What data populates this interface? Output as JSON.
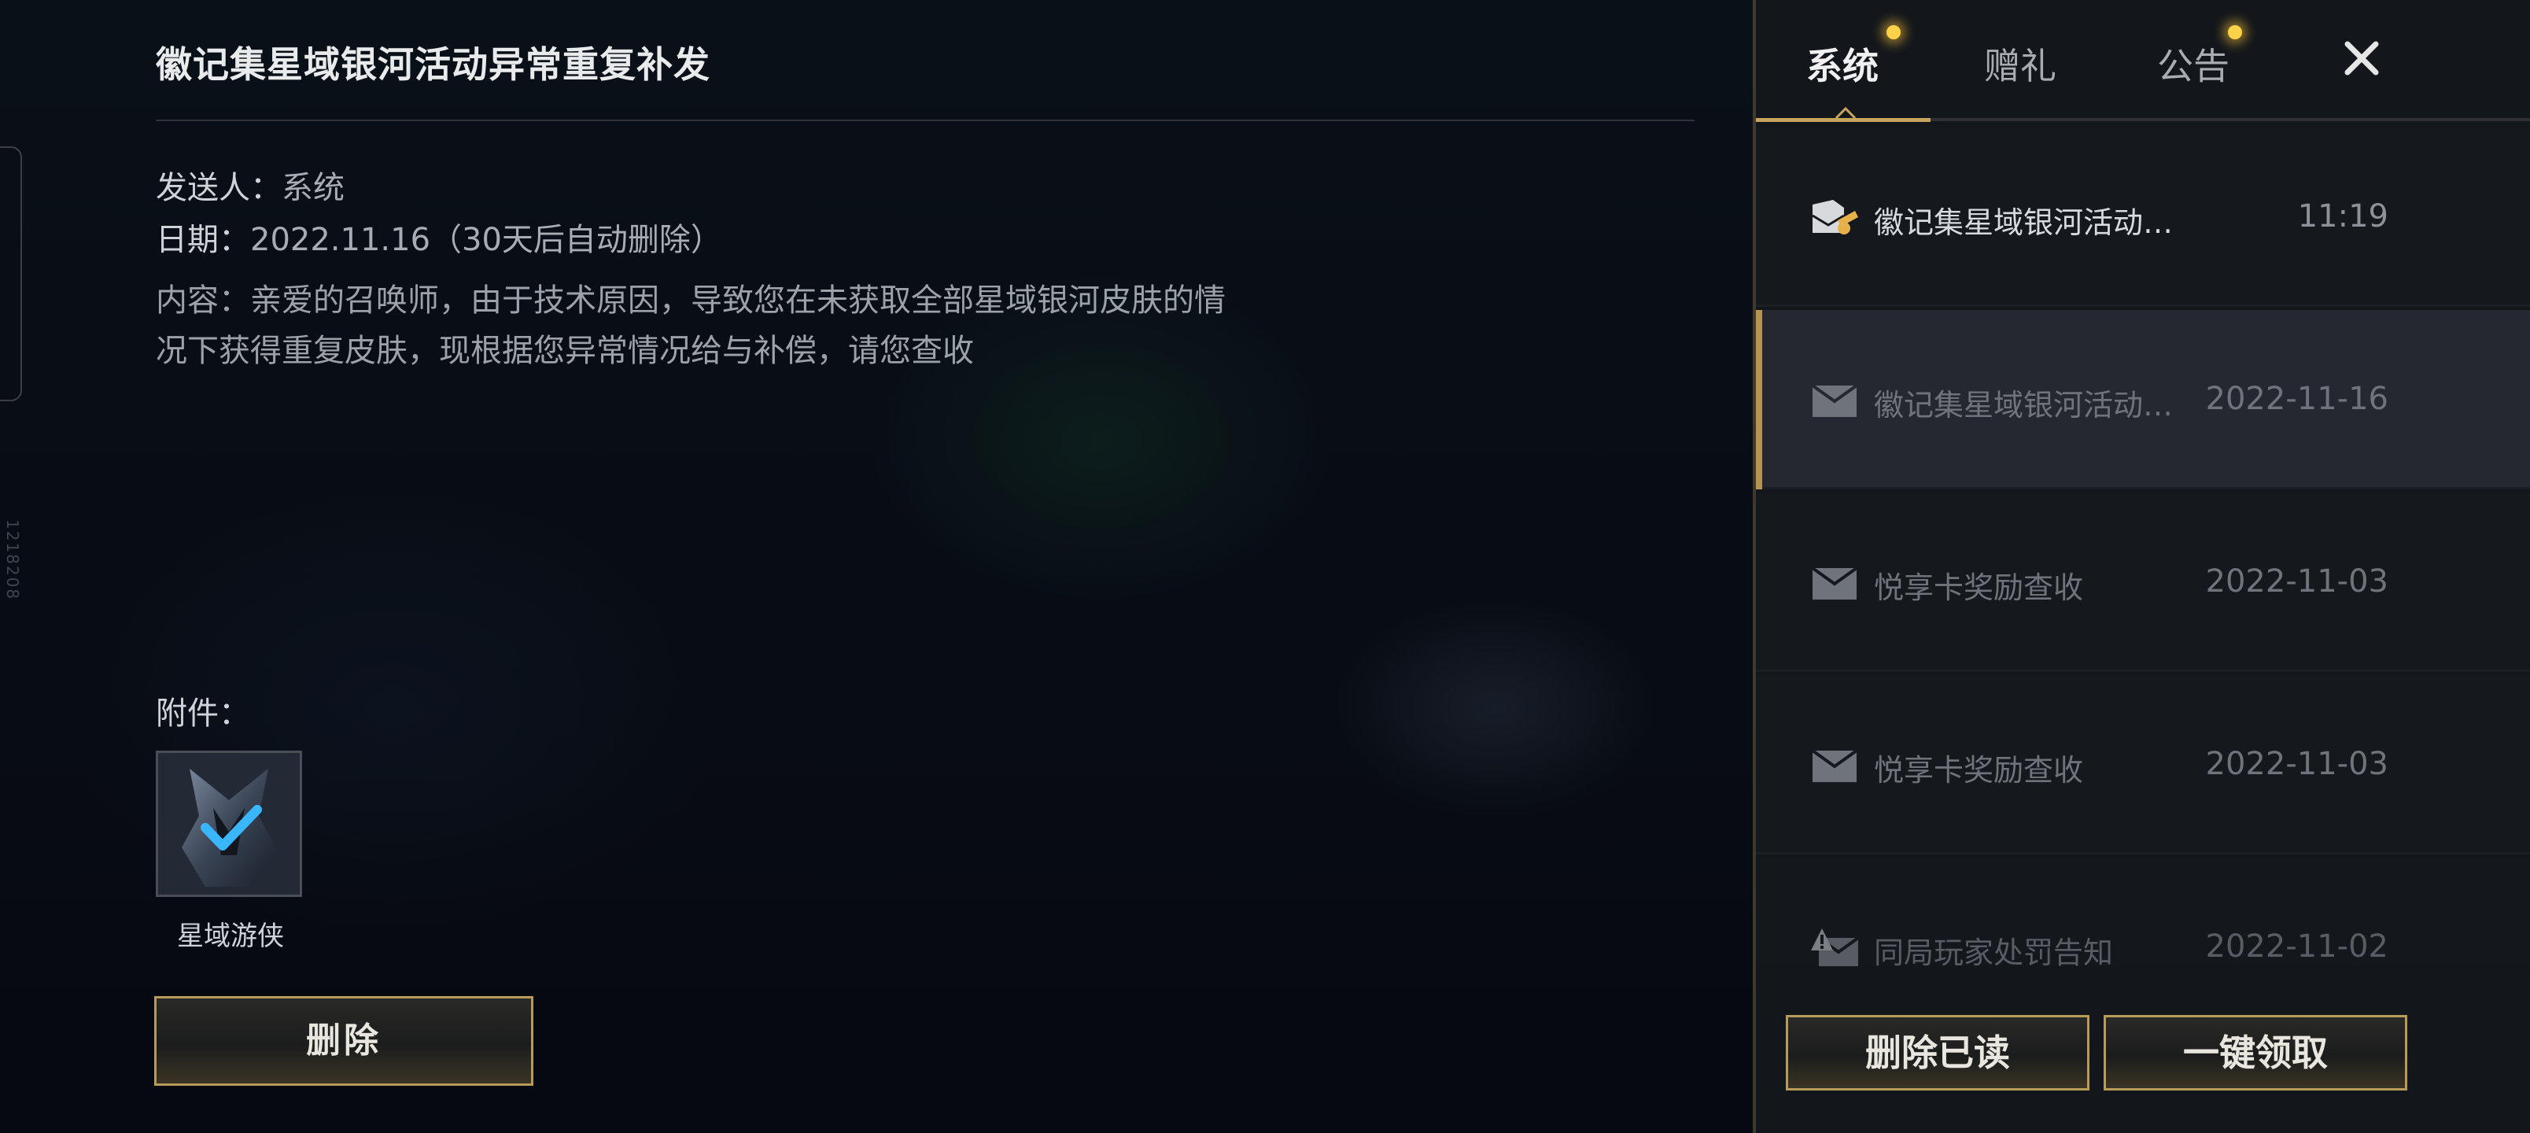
{
  "mail_detail": {
    "title": "徽记集星域银河活动异常重复补发",
    "sender_label": "发送人：",
    "sender_value": "系统",
    "date_label": "日期：",
    "date_value": "2022.11.16（30天后自动删除）",
    "content_line1": "内容：亲爱的召唤师，由于技术原因，导致您在未获取全部星域银河皮肤的情",
    "content_line2": "况下获得重复皮肤，现根据您异常情况给与补偿，请您查收",
    "attachment_label": "附件：",
    "attachment_name": "星域游侠",
    "attachment_claimed": true,
    "delete_button": "删除"
  },
  "side_code": "1218208",
  "tabs": [
    {
      "label": "系统",
      "active": true,
      "notify": true
    },
    {
      "label": "赠礼",
      "active": false,
      "notify": false
    },
    {
      "label": "公告",
      "active": false,
      "notify": true
    }
  ],
  "mails": [
    {
      "subject": "徽记集星域银河活动…",
      "time": "11:19",
      "read": false,
      "icon": "mail-attachment-icon"
    },
    {
      "subject": "徽记集星域银河活动…",
      "time": "2022-11-16",
      "read": true,
      "selected": true,
      "icon": "mail-open-icon"
    },
    {
      "subject": "悦享卡奖励查收",
      "time": "2022-11-03",
      "read": true,
      "icon": "mail-open-icon"
    },
    {
      "subject": "悦享卡奖励查收",
      "time": "2022-11-03",
      "read": true,
      "icon": "mail-open-icon"
    },
    {
      "subject": "同局玩家处罚告知",
      "time": "2022-11-02",
      "read": true,
      "icon": "mail-alert-icon"
    }
  ],
  "bottom_buttons": {
    "delete_read": "删除已读",
    "claim_all": "一键领取"
  },
  "colors": {
    "gold_border": "#b89a5a",
    "notify_dot": "#ffd24a",
    "check": "#3ab6ff"
  }
}
